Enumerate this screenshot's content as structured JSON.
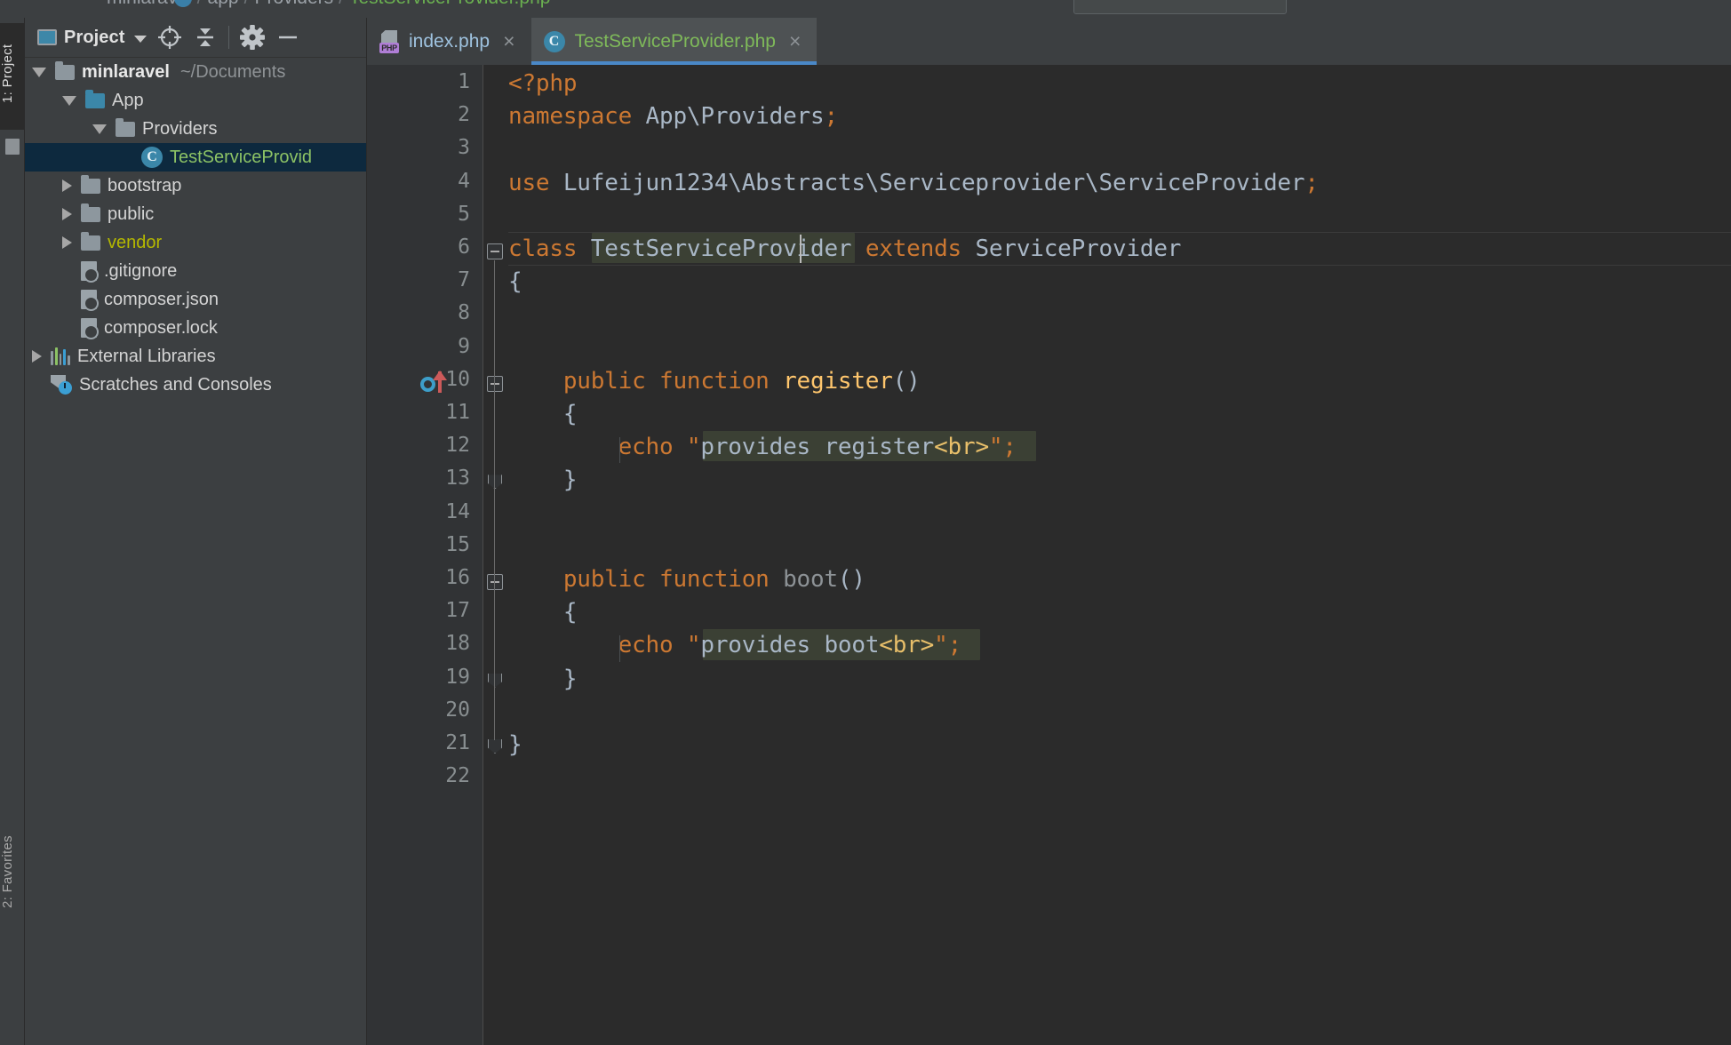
{
  "window": {
    "ghost_breadcrumb": "minlaravel  /  app  /  Providers  /  TestServiceProvider.php"
  },
  "left_rail": {
    "project_button": "1: Project",
    "favorites_button": "2: Favorites"
  },
  "project_panel": {
    "title": "Project",
    "toolbar": {
      "locate_icon": "crosshair-icon",
      "collapse_icon": "collapse-all-icon",
      "settings_icon": "gear-icon",
      "hide_icon": "minimize-icon"
    },
    "tree": [
      {
        "label": "minlaravel",
        "note": "~/Documents",
        "icon": "folder",
        "depth": 0,
        "twisty": "open",
        "style": "bold",
        "selected": false
      },
      {
        "label": "App",
        "note": "",
        "icon": "folder-blue",
        "depth": 1,
        "twisty": "open",
        "style": "normal",
        "selected": false
      },
      {
        "label": "Providers",
        "note": "",
        "icon": "folder",
        "depth": 2,
        "twisty": "open",
        "style": "normal",
        "selected": false
      },
      {
        "label": "TestServiceProvid",
        "note": "",
        "icon": "php-class",
        "depth": 3,
        "twisty": "none",
        "style": "green",
        "selected": true
      },
      {
        "label": "bootstrap",
        "note": "",
        "icon": "folder",
        "depth": 1,
        "twisty": "closed",
        "style": "normal",
        "selected": false
      },
      {
        "label": "public",
        "note": "",
        "icon": "folder",
        "depth": 1,
        "twisty": "closed",
        "style": "normal",
        "selected": false
      },
      {
        "label": "vendor",
        "note": "",
        "icon": "folder",
        "depth": 1,
        "twisty": "closed",
        "style": "yellow",
        "selected": false
      },
      {
        "label": ".gitignore",
        "note": "",
        "icon": "file-ignored",
        "depth": 1,
        "twisty": "none",
        "style": "normal",
        "selected": false
      },
      {
        "label": "composer.json",
        "note": "",
        "icon": "file-json",
        "depth": 1,
        "twisty": "none",
        "style": "normal",
        "selected": false
      },
      {
        "label": "composer.lock",
        "note": "",
        "icon": "file-json",
        "depth": 1,
        "twisty": "none",
        "style": "normal",
        "selected": false
      },
      {
        "label": "External Libraries",
        "note": "",
        "icon": "libraries",
        "depth": 0,
        "twisty": "closed",
        "style": "normal",
        "selected": false
      },
      {
        "label": "Scratches and Consoles",
        "note": "",
        "icon": "scratches",
        "depth": 0,
        "twisty": "none",
        "style": "normal",
        "selected": false
      }
    ]
  },
  "editor": {
    "tabs": [
      {
        "label": "index.php",
        "icon": "php-file-icon",
        "color": "blue",
        "active": false,
        "close": "×"
      },
      {
        "label": "TestServiceProvider.php",
        "icon": "php-class-icon",
        "color": "green",
        "active": true,
        "close": "×"
      }
    ],
    "line_numbers": [
      "1",
      "2",
      "3",
      "4",
      "5",
      "6",
      "7",
      "8",
      "9",
      "10",
      "11",
      "12",
      "13",
      "14",
      "15",
      "16",
      "17",
      "18",
      "19",
      "20",
      "21",
      "22"
    ],
    "lines": [
      {
        "n": 1,
        "segments": [
          {
            "t": "<?php",
            "c": "k"
          }
        ]
      },
      {
        "n": 2,
        "segments": [
          {
            "t": "namespace ",
            "c": "k"
          },
          {
            "t": "App\\Providers",
            "c": "id"
          },
          {
            "t": ";",
            "c": "k"
          }
        ]
      },
      {
        "n": 3,
        "segments": []
      },
      {
        "n": 4,
        "segments": [
          {
            "t": "use ",
            "c": "k"
          },
          {
            "t": "Lufeijun1234\\Abstracts\\Serviceprovider\\ServiceProvider",
            "c": "id"
          },
          {
            "t": ";",
            "c": "k"
          }
        ]
      },
      {
        "n": 5,
        "segments": []
      },
      {
        "n": 6,
        "segments": [
          {
            "t": "class ",
            "c": "k"
          },
          {
            "t": "TestServiceProvider",
            "c": "id"
          },
          {
            "t": " extends ",
            "c": "k"
          },
          {
            "t": "ServiceProvider",
            "c": "id"
          }
        ]
      },
      {
        "n": 7,
        "segments": [
          {
            "t": "{",
            "c": "punct"
          }
        ]
      },
      {
        "n": 8,
        "segments": []
      },
      {
        "n": 9,
        "segments": []
      },
      {
        "n": 10,
        "segments": [
          {
            "t": "    public function ",
            "c": "k"
          },
          {
            "t": "register",
            "c": "meth"
          },
          {
            "t": "()",
            "c": "punct"
          }
        ]
      },
      {
        "n": 11,
        "segments": [
          {
            "t": "    {",
            "c": "punct"
          }
        ]
      },
      {
        "n": 12,
        "segments": [
          {
            "t": "        echo ",
            "c": "k"
          },
          {
            "t": "\"",
            "c": "q"
          },
          {
            "t": "provides register",
            "c": "str"
          },
          {
            "t": "<br>",
            "c": "tag"
          },
          {
            "t": "\"",
            "c": "q"
          },
          {
            "t": ";",
            "c": "k"
          }
        ]
      },
      {
        "n": 13,
        "segments": [
          {
            "t": "    }",
            "c": "punct"
          }
        ]
      },
      {
        "n": 14,
        "segments": []
      },
      {
        "n": 15,
        "segments": []
      },
      {
        "n": 16,
        "segments": [
          {
            "t": "    public function ",
            "c": "k"
          },
          {
            "t": "boot",
            "c": "meth-gray"
          },
          {
            "t": "()",
            "c": "punct"
          }
        ]
      },
      {
        "n": 17,
        "segments": [
          {
            "t": "    {",
            "c": "punct"
          }
        ]
      },
      {
        "n": 18,
        "segments": [
          {
            "t": "        echo ",
            "c": "k"
          },
          {
            "t": "\"",
            "c": "q"
          },
          {
            "t": "provides boot",
            "c": "str"
          },
          {
            "t": "<br>",
            "c": "tag"
          },
          {
            "t": "\"",
            "c": "q"
          },
          {
            "t": ";",
            "c": "k"
          }
        ]
      },
      {
        "n": 19,
        "segments": [
          {
            "t": "    }",
            "c": "punct"
          }
        ]
      },
      {
        "n": 20,
        "segments": []
      },
      {
        "n": 21,
        "segments": [
          {
            "t": "}",
            "c": "punct"
          }
        ]
      },
      {
        "n": 22,
        "segments": []
      }
    ],
    "gutter_markers": [
      {
        "line": 10,
        "icon": "overriding-method-icon"
      }
    ],
    "caret": {
      "line": 6,
      "column": 21
    }
  },
  "colors": {
    "editor_background": "#2b2b2b",
    "gutter_background": "#313335",
    "panel_background": "#3c3f41",
    "selection_background": "#0d293e",
    "identifier_highlight": "#3b4034",
    "accent_blue": "#4a88c7",
    "keyword_orange": "#cc7832",
    "string_gray": "#a9b7c6",
    "method_gold": "#ffc66d",
    "tag_yellow": "#e8bf6a",
    "tree_green": "#8cc265",
    "tree_yellow": "#b5b800"
  }
}
